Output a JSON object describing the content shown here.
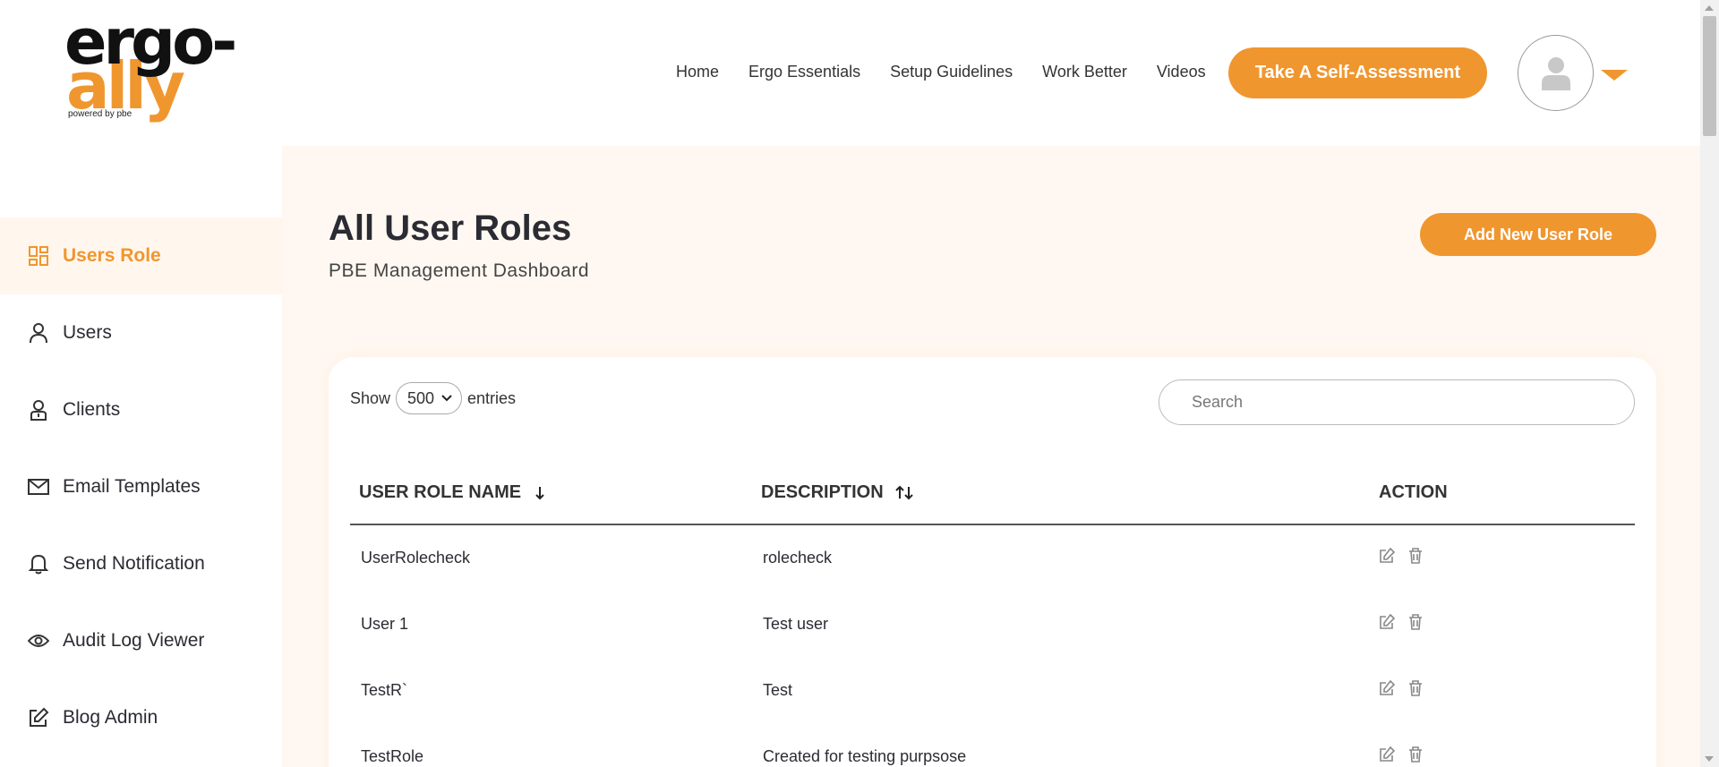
{
  "logo": {
    "line1": "ergo-",
    "line2": "ally",
    "tagline": "powered by pbe"
  },
  "nav": [
    {
      "label": "Home"
    },
    {
      "label": "Ergo Essentials"
    },
    {
      "label": "Setup Guidelines"
    },
    {
      "label": "Work Better"
    },
    {
      "label": "Videos"
    }
  ],
  "cta_label": "Take A Self-Assessment",
  "sidebar": {
    "items": [
      {
        "label": "Users Role",
        "icon": "dashboard-grid-icon",
        "active": true
      },
      {
        "label": "Users",
        "icon": "user-icon"
      },
      {
        "label": "Clients",
        "icon": "client-icon"
      },
      {
        "label": "Email Templates",
        "icon": "mail-icon"
      },
      {
        "label": "Send Notification",
        "icon": "bell-icon"
      },
      {
        "label": "Audit Log Viewer",
        "icon": "eye-icon"
      },
      {
        "label": "Blog Admin",
        "icon": "edit-icon"
      }
    ]
  },
  "main": {
    "title": "All User Roles",
    "subtitle": "PBE Management Dashboard",
    "add_button": "Add New User Role"
  },
  "table": {
    "show_label": "Show",
    "entries_value": "500",
    "entries_label": "entries",
    "search_placeholder": "Search",
    "columns": [
      "USER ROLE NAME",
      "DESCRIPTION",
      "ACTION"
    ],
    "rows": [
      {
        "name": "UserRolecheck",
        "description": "rolecheck"
      },
      {
        "name": "User 1",
        "description": "Test user"
      },
      {
        "name": "TestR`",
        "description": "Test"
      },
      {
        "name": "TestRole",
        "description": "Created for testing purpsose"
      }
    ]
  },
  "colors": {
    "accent": "#f0962f",
    "main_bg": "#fff8f2"
  }
}
